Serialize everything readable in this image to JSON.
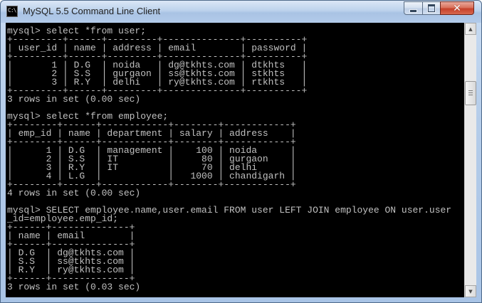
{
  "window": {
    "title": "MySQL 5.5 Command Line Client",
    "icon": "console-icon",
    "icon_glyph": "C:\\",
    "controls": {
      "minimize": "minimize-icon",
      "maximize": "maximize-icon",
      "close": "close-icon",
      "close_glyph": "✕",
      "close_color": "#c6412a"
    }
  },
  "console": {
    "background": "#000000",
    "foreground": "#c0c0c0",
    "lines": [
      "mysql> select *from user;",
      "+---------+------+---------+--------------+----------+",
      "| user_id | name | address | email        | password |",
      "+---------+------+---------+--------------+----------+",
      "|       1 | D.G  | noida   | dg@tkhts.com | dtkhts   |",
      "|       2 | S.S  | gurgaon | ss@tkhts.com | stkhts   |",
      "|       3 | R.Y  | delhi   | ry@tkhts.com | rtkhts   |",
      "+---------+------+---------+--------------+----------+",
      "3 rows in set (0.00 sec)",
      "",
      "mysql> select *from employee;",
      "+--------+------+------------+--------+------------+",
      "| emp_id | name | department | salary | address    |",
      "+--------+------+------------+--------+------------+",
      "|      1 | D.G  | management |    100 | noida      |",
      "|      2 | S.S  | IT         |     80 | gurgaon    |",
      "|      3 | R.Y  | IT         |     70 | delhi      |",
      "|      4 | L.G  |            |   1000 | chandigarh |",
      "+--------+------+------------+--------+------------+",
      "4 rows in set (0.00 sec)",
      "",
      "mysql> SELECT employee.name,user.email FROM user LEFT JOIN employee ON user.user",
      "_id=employee.emp_id;",
      "+------+--------------+",
      "| name | email        |",
      "+------+--------------+",
      "| D.G  | dg@tkhts.com |",
      "| S.S  | ss@tkhts.com |",
      "| R.Y  | ry@tkhts.com |",
      "+------+--------------+",
      "3 rows in set (0.03 sec)"
    ]
  },
  "scrollbar": {
    "up_icon": "scroll-up-arrow-icon",
    "down_icon": "scroll-down-arrow-icon",
    "up_glyph": "▲",
    "down_glyph": "▼"
  }
}
